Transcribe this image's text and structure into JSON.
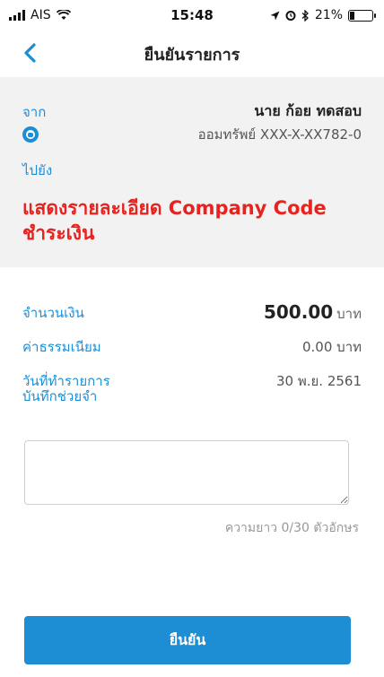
{
  "status_bar": {
    "carrier": "AIS",
    "time": "15:48",
    "battery": "21%",
    "icons": [
      "signal-icon",
      "wifi-icon",
      "location-icon",
      "alarm-icon",
      "bluetooth-icon",
      "battery-icon"
    ]
  },
  "header": {
    "title": "ยืนยันรายการ",
    "back_icon": "chevron-left-icon"
  },
  "transfer": {
    "from_label": "จาก",
    "from_name": "นาย ก้อย ทดสอบ",
    "bank_icon": "bank-logo-icon",
    "from_account": "ออมทรัพย์ XXX-X-XX782-0",
    "to_label": "ไปยัง",
    "company_line1": "แสดงรายละเอียด Company Code",
    "company_line2": "ชำระเงิน"
  },
  "details": {
    "amount_label": "จำนวนเงิน",
    "amount_value": "500.00",
    "amount_unit": "บาท",
    "fee_label": "ค่าธรรมเนียม",
    "fee_value": "0.00 บาท",
    "date_label": "วันที่ทำรายการ",
    "date_value": "30 พ.ย. 2561"
  },
  "memo": {
    "label": "บันทึกช่วยจำ",
    "value": "",
    "counter": "ความยาว 0/30 ตัวอักษร"
  },
  "actions": {
    "confirm_label": "ยืนยัน"
  },
  "colors": {
    "accent": "#1e8ed4",
    "highlight_red": "#e8231f",
    "panel_bg": "#f2f2f3"
  }
}
